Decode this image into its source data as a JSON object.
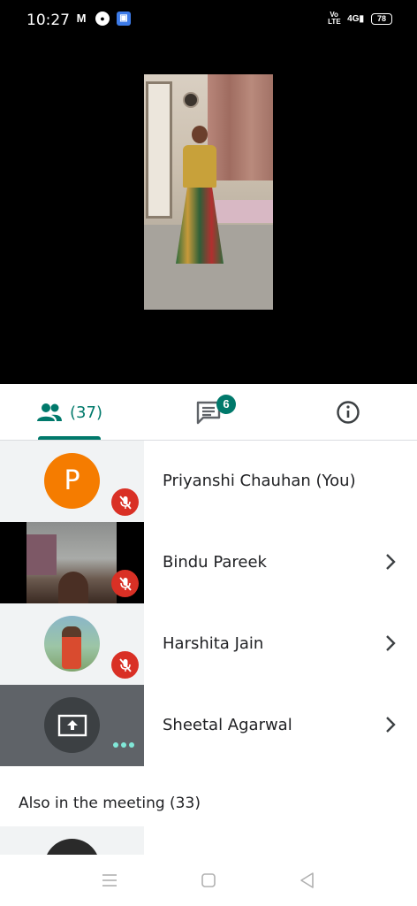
{
  "status_bar": {
    "time": "10:27",
    "app_icons": [
      "gmail-icon",
      "chat-icon",
      "android-icon"
    ],
    "volte": "Vo LTE",
    "network": "4G",
    "battery": "78"
  },
  "tabs": {
    "people_count": "(37)",
    "chat_badge": "6"
  },
  "participants": [
    {
      "name": "Priyanshi Chauhan (You)",
      "avatar_letter": "P",
      "muted": true
    },
    {
      "name": "Bindu Pareek",
      "muted": true
    },
    {
      "name": "Harshita Jain",
      "muted": true
    },
    {
      "name": "Sheetal Agarwal",
      "presenting": true
    }
  ],
  "also_in_meeting": "Also in the meeting (33)",
  "colors": {
    "accent": "#00796b",
    "mute_red": "#d93025",
    "avatar_orange": "#f57c00"
  }
}
